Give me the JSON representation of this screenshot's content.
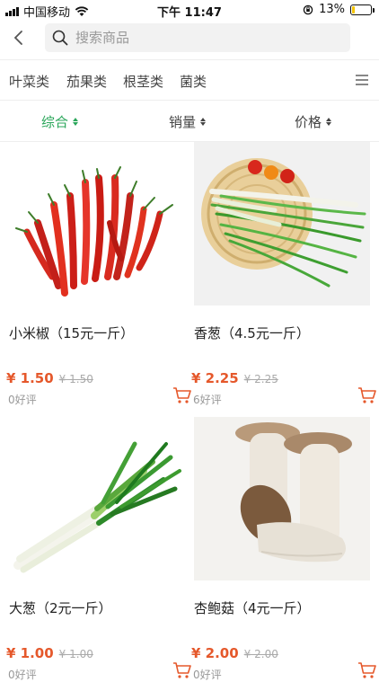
{
  "status": {
    "carrier": "中国移动",
    "time": "下午 11:47",
    "battery": "13%",
    "battery_level": 0.13
  },
  "search": {
    "placeholder": "搜索商品"
  },
  "categories": [
    "叶菜类",
    "茄果类",
    "根茎类",
    "菌类"
  ],
  "sort": {
    "items": [
      "综合",
      "销量",
      "价格"
    ],
    "active_index": 0
  },
  "colors": {
    "accent_green": "#2aa65a",
    "price_red": "#e5582b"
  },
  "products": [
    {
      "name": "小米椒（15元一斤）",
      "price": "¥ 1.50",
      "original_price": "¥ 1.50",
      "reviews": "0好评",
      "image": "red-chili-peppers"
    },
    {
      "name": "香葱（4.5元一斤）",
      "price": "¥ 2.25",
      "original_price": "¥ 2.25",
      "reviews": "6好评",
      "image": "green-onions-in-basket"
    },
    {
      "name": "大葱（2元一斤）",
      "price": "¥ 1.00",
      "original_price": "¥ 1.00",
      "reviews": "0好评",
      "image": "leek-bundle"
    },
    {
      "name": "杏鲍菇（4元一斤）",
      "price": "¥ 2.00",
      "original_price": "¥ 2.00",
      "reviews": "0好评",
      "image": "king-oyster-mushrooms"
    }
  ]
}
